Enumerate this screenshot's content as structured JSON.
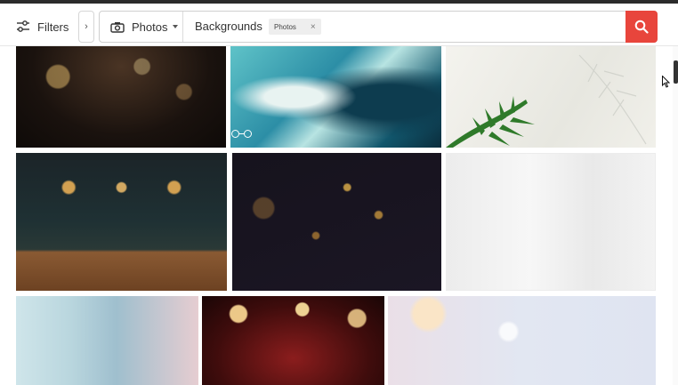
{
  "toolbar": {
    "filters_label": "Filters",
    "collapse_glyph": "›",
    "type_select": {
      "value": "Photos",
      "icon": "camera-icon"
    },
    "query": "Backgrounds",
    "chip": {
      "label": "Photos",
      "remove_glyph": "×"
    },
    "search_icon": "search-icon"
  },
  "colors": {
    "accent": "#e8453c"
  },
  "results": [
    {
      "icon": "image-thumbnail",
      "subject": "dark bokeh lights"
    },
    {
      "icon": "image-thumbnail",
      "subject": "teal marble swirl"
    },
    {
      "icon": "image-thumbnail",
      "subject": "palm leaf shadow"
    },
    {
      "icon": "image-thumbnail",
      "subject": "wooden table with bar lights"
    },
    {
      "icon": "image-thumbnail",
      "subject": "gold glitter bokeh"
    },
    {
      "icon": "image-thumbnail",
      "subject": "blurred white interior"
    },
    {
      "icon": "image-thumbnail",
      "subject": "pastel blur"
    },
    {
      "icon": "image-thumbnail",
      "subject": "red bokeh lights"
    },
    {
      "icon": "image-thumbnail",
      "subject": "silver glitter bokeh"
    }
  ]
}
